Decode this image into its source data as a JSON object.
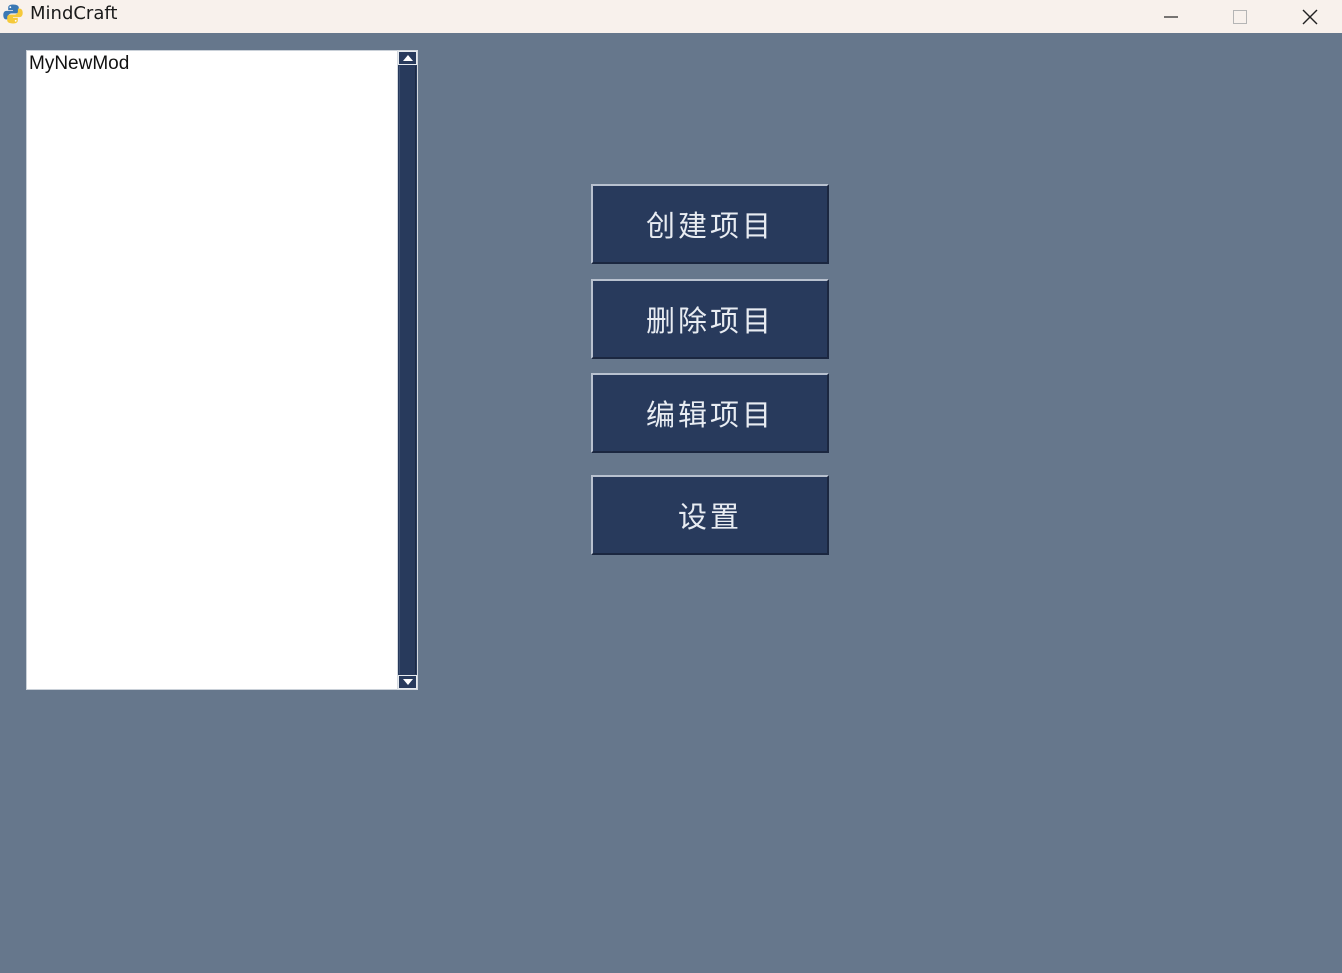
{
  "window": {
    "title": "MindCraft",
    "icon": "python-icon",
    "controls": [
      "minimize-icon",
      "maximize-icon",
      "close-icon"
    ]
  },
  "project_list": {
    "items": [
      "MyNewMod"
    ]
  },
  "actions": {
    "create_label": "创建项目",
    "delete_label": "删除项目",
    "edit_label": "编辑项目",
    "settings_label": "设置"
  },
  "colors": {
    "background": "#66778c",
    "button": "#283a5c",
    "titlebar": "#f8f1ec"
  }
}
